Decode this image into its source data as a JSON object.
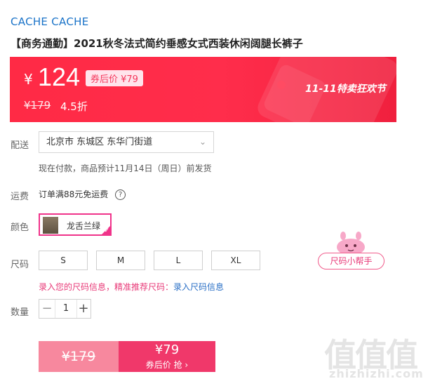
{
  "brand": "CACHE CACHE",
  "title": "【商务通勤】2021秋冬法式简约垂感女式西装休闲阔腿长裤子",
  "banner": {
    "currency": "¥",
    "price": "124",
    "coupon_label": "券后价 ¥79",
    "original_price": "¥179",
    "discount": "4.5折",
    "event_text": "11-11特卖狂欢节",
    "background_color": "#ff2a45"
  },
  "delivery": {
    "label": "配送",
    "address": "北京市 东城区 东华门街道",
    "note": "现在付款，商品预计11月14日（周日）前发货"
  },
  "freight": {
    "label": "运费",
    "text": "订单满88元免运费",
    "help_icon": "?"
  },
  "color": {
    "label": "颜色",
    "selected": "龙舌兰绿"
  },
  "size": {
    "label": "尺码",
    "options": [
      "S",
      "M",
      "L",
      "XL"
    ],
    "helper_label": "尺码小帮手",
    "tip_prefix": "录入您的尺码信息，精准推荐尺码：",
    "tip_link": "录入尺码信息"
  },
  "quantity": {
    "label": "数量",
    "minus": "−",
    "value": "1",
    "plus": "+"
  },
  "buy": {
    "original": "¥179",
    "coupon_price": "¥79",
    "action": "券后价 抢 ›",
    "accent": "#f0386a"
  },
  "watermark": {
    "logo": "值值值",
    "url": "zhizhizhi.com"
  }
}
